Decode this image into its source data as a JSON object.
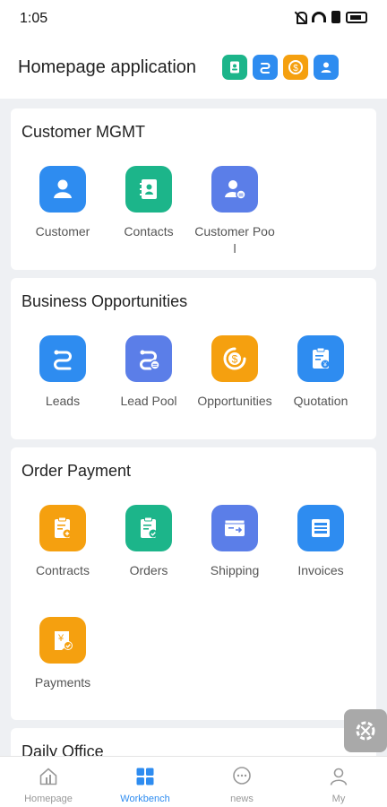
{
  "status": {
    "time": "1:05"
  },
  "header": {
    "title": "Homepage application"
  },
  "sections": {
    "customer": {
      "title": "Customer MGMT",
      "items": [
        "Customer",
        "Contacts",
        "Customer Pool"
      ]
    },
    "business": {
      "title": "Business Opportunities",
      "items": [
        "Leads",
        "Lead Pool",
        "Opportunities",
        "Quotation"
      ]
    },
    "order": {
      "title": "Order Payment",
      "items": [
        "Contracts",
        "Orders",
        "Shipping",
        "Invoices",
        "Payments"
      ]
    },
    "daily": {
      "title": "Daily Office"
    }
  },
  "tabs": [
    "Homepage",
    "Workbench",
    "news",
    "My"
  ],
  "colors": {
    "blue": "#2e8cf0",
    "teal": "#1cb58a",
    "indigo": "#5b7ee8",
    "orange": "#f5a00f",
    "active_tab": "#2e8cf0"
  }
}
